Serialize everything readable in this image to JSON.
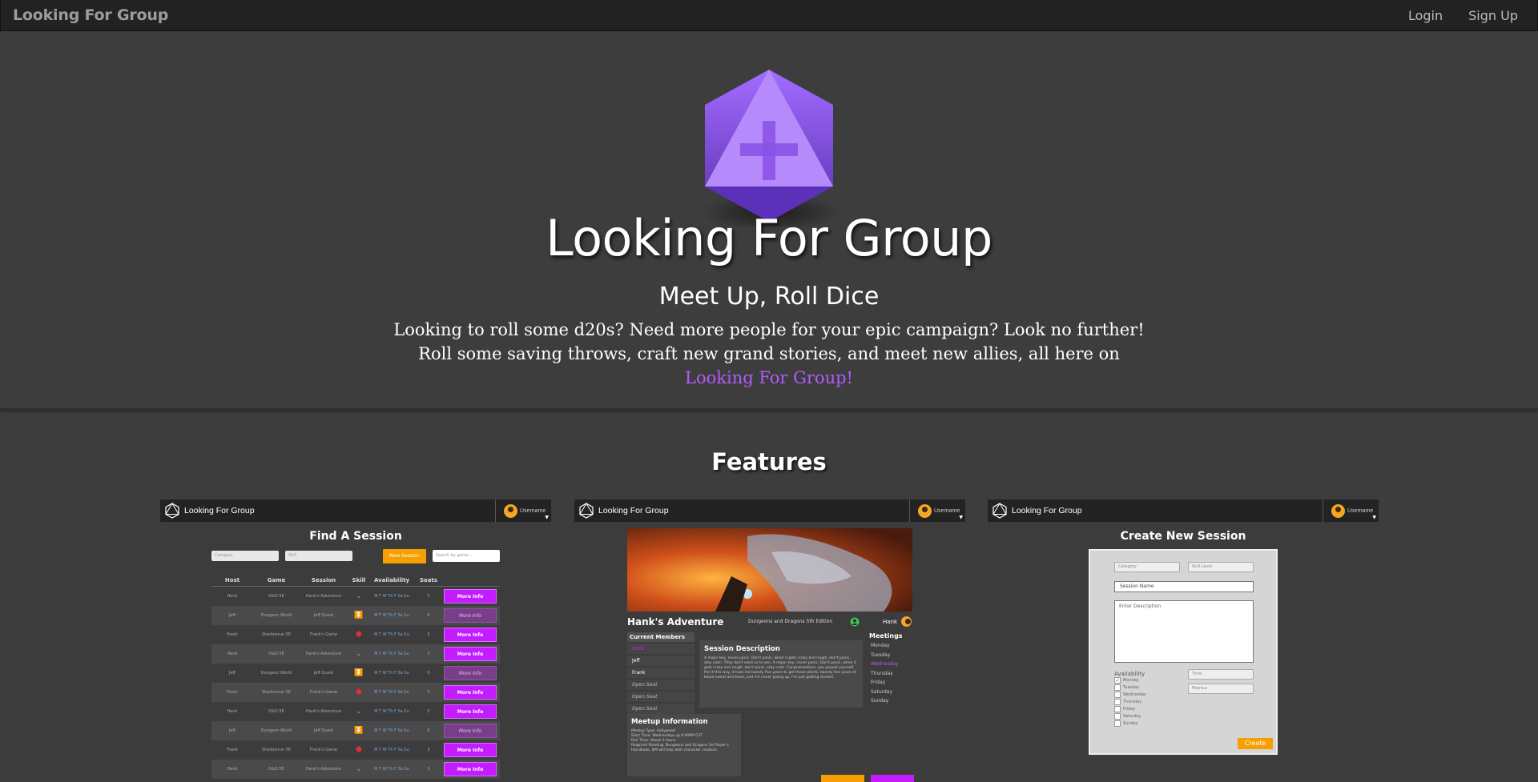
{
  "navbar": {
    "brand": "Looking For Group",
    "login": "Login",
    "signup": "Sign Up"
  },
  "hero": {
    "logo_icon": "d20-plus-icon",
    "title": "Looking For Group",
    "subtitle": "Meet Up, Roll Dice",
    "description": "Looking to roll some d20s? Need more people for your epic campaign? Look no further! Roll some saving throws, craft new grand stories, and meet new allies, all here on ",
    "description_link": "Looking For Group!",
    "accent_color": "#b35bff"
  },
  "features": {
    "title": "Features",
    "panel_brand": "Looking For Group",
    "panel_username": "Username",
    "find": {
      "title": "Find A Session",
      "category_placeholder": "Category",
      "skill_placeholder": "Skill",
      "new_session": "New Session",
      "search_placeholder": "Search by game...",
      "headers": [
        "Host",
        "Game",
        "Session",
        "Skill",
        "Availability",
        "Seats"
      ],
      "rows": [
        {
          "host": "Hank",
          "game": "D&D 5E",
          "session": "Hank's Adventure",
          "skill": "green",
          "avail": "M T W Th F Sa Su",
          "seats": "3",
          "btn": "More Info",
          "dim": false
        },
        {
          "host": "Jeff",
          "game": "Dungeon World",
          "session": "Jeff Quest",
          "skill": "orange",
          "avail": "M T W Th F Sa Su",
          "seats": "0",
          "btn": "More Info",
          "dim": true
        },
        {
          "host": "Frank",
          "game": "Shadowrun 5E",
          "session": "Frank's Game",
          "skill": "red",
          "avail": "M T W Th F Sa Su",
          "seats": "3",
          "btn": "More Info",
          "dim": false
        },
        {
          "host": "Hank",
          "game": "D&D 5E",
          "session": "Hank's Adventure",
          "skill": "green",
          "avail": "M T W Th F Sa Su",
          "seats": "3",
          "btn": "More Info",
          "dim": false
        },
        {
          "host": "Jeff",
          "game": "Dungeon World",
          "session": "Jeff Quest",
          "skill": "orange",
          "avail": "M T W Th F Sa Su",
          "seats": "0",
          "btn": "More Info",
          "dim": true
        },
        {
          "host": "Frank",
          "game": "Shadowrun 5E",
          "session": "Frank's Game",
          "skill": "red",
          "avail": "M T W Th F Sa Su",
          "seats": "3",
          "btn": "More Info",
          "dim": false
        },
        {
          "host": "Hank",
          "game": "D&D 5E",
          "session": "Hank's Adventure",
          "skill": "green",
          "avail": "M T W Th F Sa Su",
          "seats": "3",
          "btn": "More Info",
          "dim": false
        },
        {
          "host": "Jeff",
          "game": "Dungeon World",
          "session": "Jeff Quest",
          "skill": "orange",
          "avail": "M T W Th F Sa Su",
          "seats": "0",
          "btn": "More Info",
          "dim": true
        },
        {
          "host": "Frank",
          "game": "Shadowrun 5E",
          "session": "Frank's Game",
          "skill": "red",
          "avail": "M T W Th F Sa Su",
          "seats": "3",
          "btn": "More Info",
          "dim": false
        },
        {
          "host": "Hank",
          "game": "D&D 5E",
          "session": "Hank's Adventure",
          "skill": "green",
          "avail": "M T W Th F Sa Su",
          "seats": "3",
          "btn": "More Info",
          "dim": false
        }
      ]
    },
    "detail": {
      "title": "Hank's Adventure",
      "game": "Dungeons and Dragons 5th Edition",
      "host": "Hank",
      "members_header": "Current Members",
      "members": [
        {
          "name": "Hank",
          "style": "purple"
        },
        {
          "name": "Jeff",
          "style": ""
        },
        {
          "name": "Frank",
          "style": ""
        },
        {
          "name": "Open Seat",
          "style": "open"
        },
        {
          "name": "Open Seat",
          "style": "open"
        },
        {
          "name": "Open Seat",
          "style": "open"
        }
      ],
      "desc_header": "Session Description",
      "desc_text": "A major key, never panic. Don't panic, when it gets crazy and rough, don't panic, stay calm. They don't want us to win. A major key, never panic. Don't panic, when it gets crazy and rough, don't panic, stay calm. Congratulations, you played yourself. Put it this way, it took me twenty five years to get these plants, twenty five years of blood sweat and tears, and I'm never giving up, I'm just getting started.",
      "meetings_header": "Meetings",
      "days": [
        {
          "day": "Monday",
          "on": false
        },
        {
          "day": "Tuesday",
          "on": false
        },
        {
          "day": "Wednesday",
          "on": true
        },
        {
          "day": "Thursday",
          "on": false
        },
        {
          "day": "Friday",
          "on": false
        },
        {
          "day": "Saturday",
          "on": false
        },
        {
          "day": "Sunday",
          "on": false
        }
      ],
      "info_header": "Meetup Information",
      "info_lines": [
        "Meetup Type: Hollywood",
        "Start Time: Wednesdays @ 8:00PM CST",
        "Run Time: About 3 hours",
        "Required Reading: Dungeons and Dragons 5e Player's Handbook, DM will help with character creation"
      ]
    },
    "create": {
      "title": "Create New Session",
      "category": "Category",
      "skill_level": "Skill Level",
      "session_name": "Session Name",
      "description": "Enter Description",
      "availability": "Availability",
      "days": [
        {
          "day": "Monday",
          "checked": true
        },
        {
          "day": "Tuesday",
          "checked": false
        },
        {
          "day": "Wednesday",
          "checked": false
        },
        {
          "day": "Thursday",
          "checked": false
        },
        {
          "day": "Friday",
          "checked": false
        },
        {
          "day": "Saturday",
          "checked": false
        },
        {
          "day": "Sunday",
          "checked": false
        }
      ],
      "time_placeholder": "Time",
      "meetup": "Meetup",
      "create_button": "Create"
    }
  }
}
